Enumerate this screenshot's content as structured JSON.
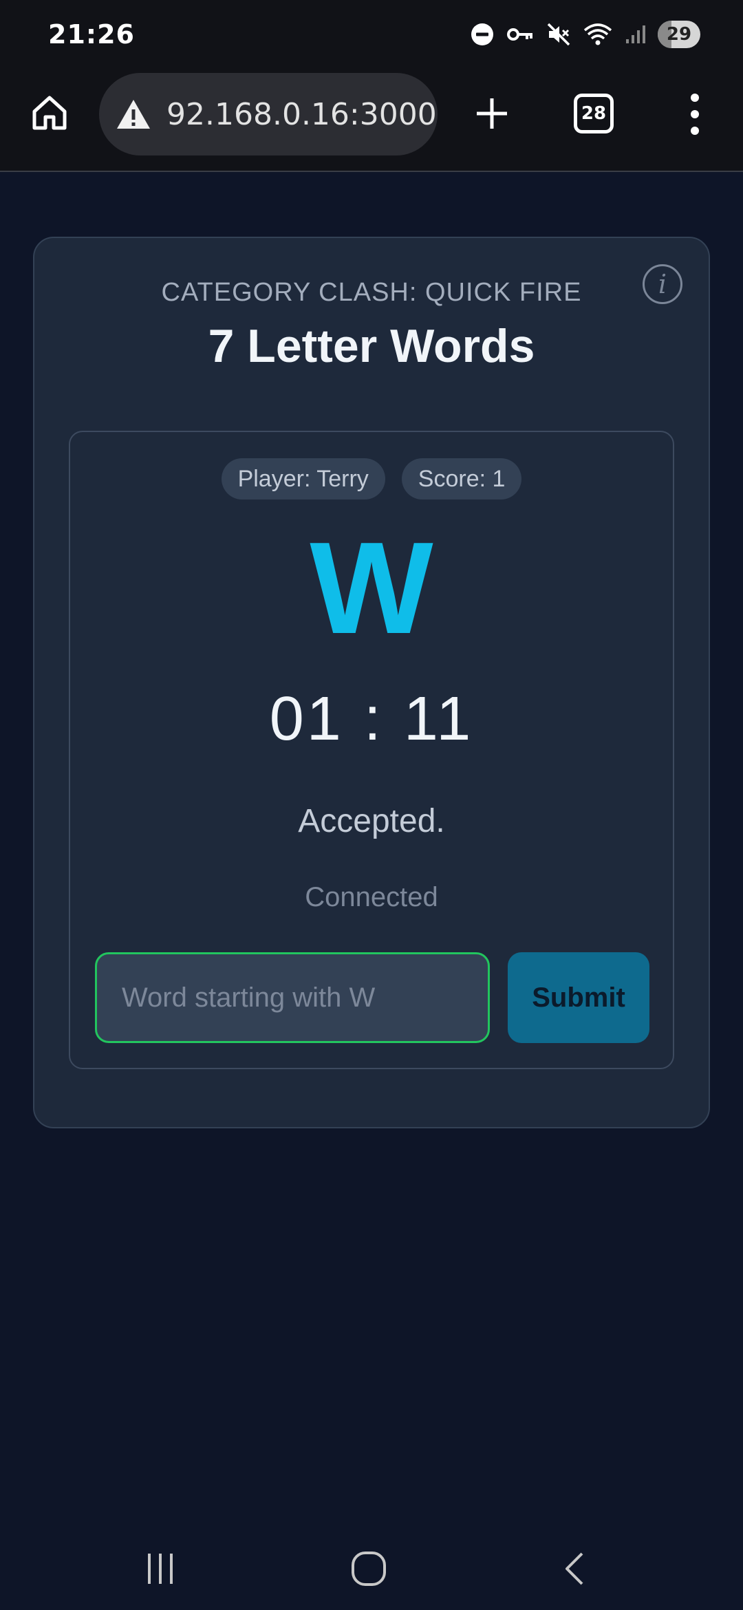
{
  "status_bar": {
    "time": "21:26",
    "battery": "29",
    "icons": [
      "do-not-disturb-icon",
      "vpn-key-icon",
      "mute-icon",
      "wifi-icon",
      "signal-icon",
      "battery-icon"
    ]
  },
  "browser": {
    "url": "92.168.0.16:3000",
    "tab_count": "28",
    "icons": [
      "home-icon",
      "warning-icon",
      "plus-icon",
      "tabs-icon",
      "more-vert-icon"
    ]
  },
  "game": {
    "subtitle": "CATEGORY CLASH: QUICK FIRE",
    "title": "7 Letter Words",
    "info_icon_glyph": "i",
    "player_badge": "Player: Terry",
    "score_badge": "Score: 1",
    "letter": "W",
    "timer": "01 : 11",
    "status": "Accepted.",
    "connection": "Connected",
    "input": {
      "value": "",
      "placeholder": "Word starting with W"
    },
    "submit_label": "Submit"
  },
  "colors": {
    "background": "#0e1528",
    "card": "#1e293b",
    "accent_letter": "#0fbde9",
    "input_border": "#22c55e",
    "submit_bg": "#0e6a8e"
  },
  "nav": {
    "icons": [
      "recent-apps-icon",
      "home-circle-icon",
      "back-icon"
    ]
  }
}
